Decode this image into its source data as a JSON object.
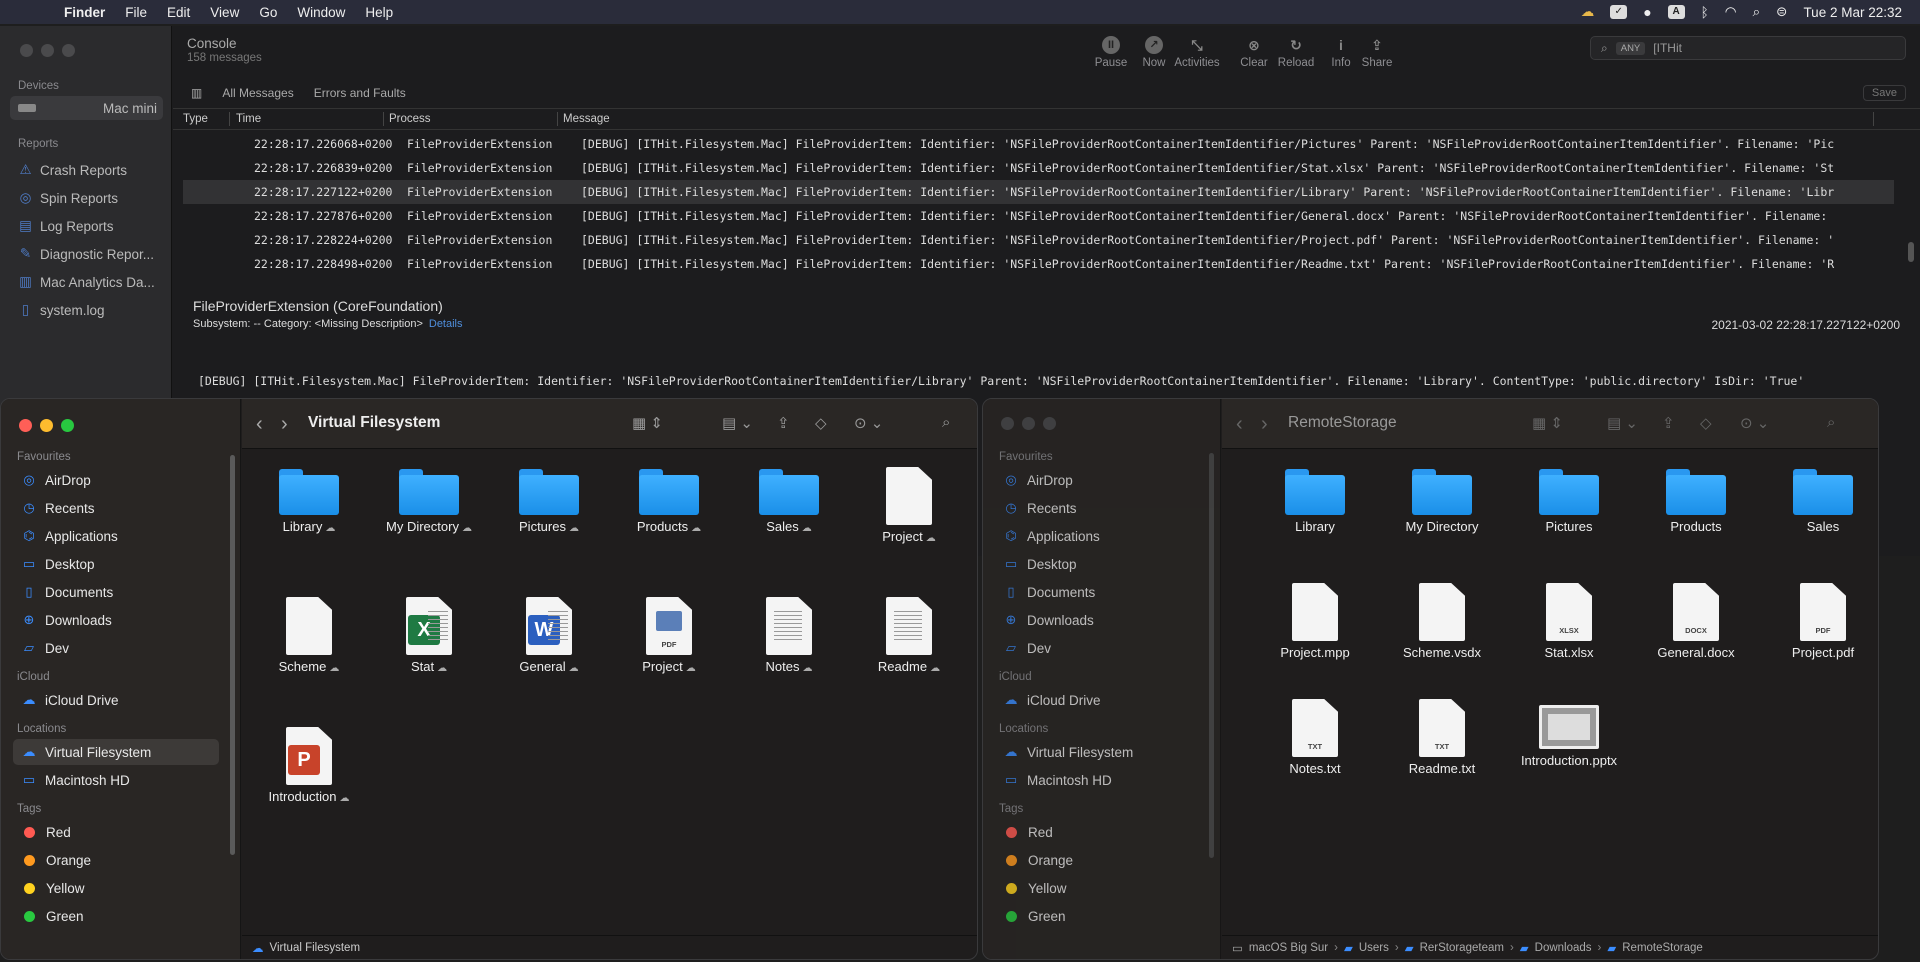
{
  "menubar": {
    "apple": "",
    "app": "Finder",
    "items": [
      "File",
      "Edit",
      "View",
      "Go",
      "Window",
      "Help"
    ],
    "clock": "Tue 2 Mar  22:32",
    "a_label": "A"
  },
  "console": {
    "title": "Console",
    "subtitle": "158 messages",
    "devices_header": "Devices",
    "device": "Mac mini",
    "reports_header": "Reports",
    "reports": [
      "Crash Reports",
      "Spin Reports",
      "Log Reports",
      "Diagnostic Repor...",
      "Mac Analytics Da...",
      "system.log"
    ],
    "toolbar": [
      {
        "label": "Pause",
        "glyph": "II"
      },
      {
        "label": "Now",
        "glyph": "↗"
      },
      {
        "label": "Activities",
        "glyph": "⤡"
      },
      {
        "label": "Clear",
        "glyph": "⊗"
      },
      {
        "label": "Reload",
        "glyph": "↻"
      },
      {
        "label": "Info",
        "glyph": "i"
      },
      {
        "label": "Share",
        "glyph": "⇪"
      }
    ],
    "search": {
      "scope": "ANY",
      "value": "[ITHit"
    },
    "filters": [
      "All Messages",
      "Errors and Faults"
    ],
    "save": "Save",
    "columns": [
      "Type",
      "Time",
      "Process",
      "Message"
    ],
    "rows": [
      {
        "time": "22:28:17.226068+0200",
        "process": "FileProviderExtension",
        "message": "[DEBUG] [ITHit.Filesystem.Mac] FileProviderItem: Identifier: 'NSFileProviderRootContainerItemIdentifier/Pictures' Parent: 'NSFileProviderRootContainerItemIdentifier'. Filename: 'Pic"
      },
      {
        "time": "22:28:17.226839+0200",
        "process": "FileProviderExtension",
        "message": "[DEBUG] [ITHit.Filesystem.Mac] FileProviderItem: Identifier: 'NSFileProviderRootContainerItemIdentifier/Stat.xlsx' Parent: 'NSFileProviderRootContainerItemIdentifier'. Filename: 'St"
      },
      {
        "time": "22:28:17.227122+0200",
        "process": "FileProviderExtension",
        "message": "[DEBUG] [ITHit.Filesystem.Mac] FileProviderItem: Identifier: 'NSFileProviderRootContainerItemIdentifier/Library' Parent: 'NSFileProviderRootContainerItemIdentifier'. Filename: 'Libr"
      },
      {
        "time": "22:28:17.227876+0200",
        "process": "FileProviderExtension",
        "message": "[DEBUG] [ITHit.Filesystem.Mac] FileProviderItem: Identifier: 'NSFileProviderRootContainerItemIdentifier/General.docx' Parent: 'NSFileProviderRootContainerItemIdentifier'. Filename:"
      },
      {
        "time": "22:28:17.228224+0200",
        "process": "FileProviderExtension",
        "message": "[DEBUG] [ITHit.Filesystem.Mac] FileProviderItem: Identifier: 'NSFileProviderRootContainerItemIdentifier/Project.pdf' Parent: 'NSFileProviderRootContainerItemIdentifier'. Filename: '"
      },
      {
        "time": "22:28:17.228498+0200",
        "process": "FileProviderExtension",
        "message": "[DEBUG] [ITHit.Filesystem.Mac] FileProviderItem: Identifier: 'NSFileProviderRootContainerItemIdentifier/Readme.txt' Parent: 'NSFileProviderRootContainerItemIdentifier'. Filename: 'R"
      }
    ],
    "detail": {
      "title": "FileProviderExtension (CoreFoundation)",
      "sub": "Subsystem: --   Category: <Missing Description>",
      "details_link": "Details",
      "date": "2021-03-02 22:28:17.227122+0200",
      "message": "[DEBUG] [ITHit.Filesystem.Mac] FileProviderItem: Identifier: 'NSFileProviderRootContainerItemIdentifier/Library' Parent: 'NSFileProviderRootContainerItemIdentifier'. Filename: 'Library'. ContentType: 'public.directory' IsDir: 'True'"
    }
  },
  "finder_left": {
    "title": "Virtual Filesystem",
    "sidebar": {
      "favourites_header": "Favourites",
      "favourites": [
        {
          "label": "AirDrop",
          "icon": "◎"
        },
        {
          "label": "Recents",
          "icon": "◷"
        },
        {
          "label": "Applications",
          "icon": "⌬"
        },
        {
          "label": "Desktop",
          "icon": "▭"
        },
        {
          "label": "Documents",
          "icon": "▯"
        },
        {
          "label": "Downloads",
          "icon": "⊕"
        },
        {
          "label": "Dev",
          "icon": "▱"
        }
      ],
      "icloud_header": "iCloud",
      "icloud": [
        {
          "label": "iCloud Drive",
          "icon": "☁"
        }
      ],
      "locations_header": "Locations",
      "locations": [
        {
          "label": "Virtual Filesystem",
          "icon": "☁"
        },
        {
          "label": "Macintosh HD",
          "icon": "▭"
        }
      ],
      "tags_header": "Tags",
      "tags": [
        {
          "label": "Red",
          "color": "#ff5a52"
        },
        {
          "label": "Orange",
          "color": "#ff9a1f"
        },
        {
          "label": "Yellow",
          "color": "#ffd21f"
        },
        {
          "label": "Green",
          "color": "#29c940"
        }
      ]
    },
    "items": [
      {
        "label": "Library",
        "kind": "folder"
      },
      {
        "label": "My Directory",
        "kind": "folder"
      },
      {
        "label": "Pictures",
        "kind": "folder"
      },
      {
        "label": "Products",
        "kind": "folder"
      },
      {
        "label": "Sales",
        "kind": "folder"
      },
      {
        "label": "Project",
        "kind": "doc",
        "tag": ""
      },
      {
        "label": "Scheme",
        "kind": "doc",
        "tag": ""
      },
      {
        "label": "Stat",
        "kind": "xlsx",
        "tag": "X"
      },
      {
        "label": "General",
        "kind": "docx",
        "tag": "W"
      },
      {
        "label": "Project",
        "kind": "pdf",
        "tag": "PDF"
      },
      {
        "label": "Notes",
        "kind": "txt",
        "tag": ""
      },
      {
        "label": "Readme",
        "kind": "txt",
        "tag": ""
      },
      {
        "label": "Introduction",
        "kind": "pptx",
        "tag": "P"
      }
    ],
    "pathbar": "Virtual Filesystem"
  },
  "finder_right": {
    "title": "RemoteStorage",
    "items": [
      {
        "label": "Library",
        "kind": "folder"
      },
      {
        "label": "My Directory",
        "kind": "folder"
      },
      {
        "label": "Pictures",
        "kind": "folder"
      },
      {
        "label": "Products",
        "kind": "folder"
      },
      {
        "label": "Sales",
        "kind": "folder"
      },
      {
        "label": "Project.mpp",
        "kind": "doc",
        "tag": ""
      },
      {
        "label": "Scheme.vsdx",
        "kind": "doc",
        "tag": ""
      },
      {
        "label": "Stat.xlsx",
        "kind": "doc",
        "tag": "XLSX"
      },
      {
        "label": "General.docx",
        "kind": "doc",
        "tag": "DOCX"
      },
      {
        "label": "Project.pdf",
        "kind": "doc",
        "tag": "PDF"
      },
      {
        "label": "Notes.txt",
        "kind": "doc",
        "tag": "TXT"
      },
      {
        "label": "Readme.txt",
        "kind": "doc",
        "tag": "TXT"
      },
      {
        "label": "Introduction.pptx",
        "kind": "slide",
        "tag": ""
      }
    ],
    "path": [
      "macOS Big Sur",
      "Users",
      "RerStorageteam",
      "Downloads",
      "RemoteStorage"
    ]
  }
}
